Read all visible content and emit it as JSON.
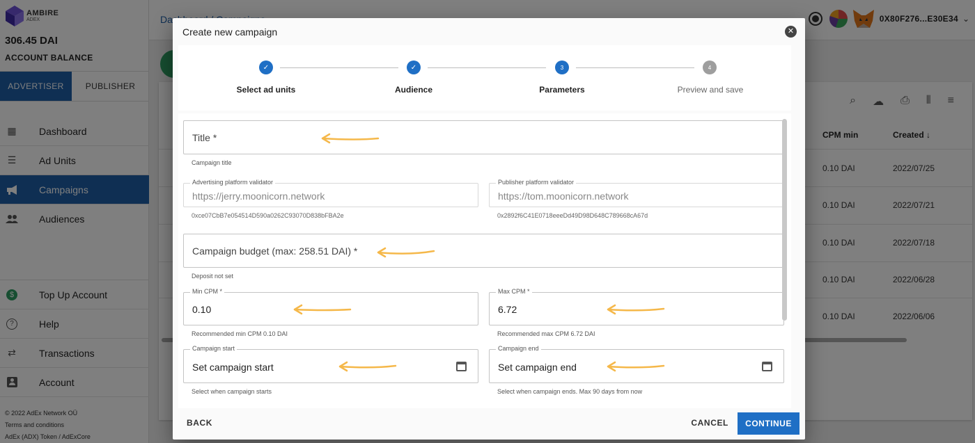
{
  "brand": {
    "name": "AMBIRE",
    "sub": "ADEX"
  },
  "sidebar": {
    "balance": "306.45 DAI",
    "balance_label": "ACCOUNT BALANCE",
    "tabs": [
      "ADVERTISER",
      "PUBLISHER"
    ],
    "items": [
      {
        "label": "Dashboard",
        "icon": "dashboard-icon"
      },
      {
        "label": "Ad Units",
        "icon": "list-icon"
      },
      {
        "label": "Campaigns",
        "icon": "megaphone-icon"
      },
      {
        "label": "Audiences",
        "icon": "people-icon"
      },
      {
        "label": "Top Up Account",
        "icon": "dollar-icon"
      },
      {
        "label": "Help",
        "icon": "help-icon"
      },
      {
        "label": "Transactions",
        "icon": "swap-icon"
      },
      {
        "label": "Account",
        "icon": "account-icon"
      }
    ],
    "footer": [
      "© 2022  AdEx Network OÜ",
      "Terms and conditions",
      "AdEx (ADX) Token / AdExCore"
    ]
  },
  "header": {
    "breadcrumb": "Dashboard / Campaigns",
    "account": "0X80F276...E30E34"
  },
  "table": {
    "columns": [
      "CPM min",
      "Created"
    ],
    "rows": [
      {
        "cpm": "0.10 DAI",
        "created": "2022/07/25"
      },
      {
        "cpm": "0.10 DAI",
        "created": "2022/07/21"
      },
      {
        "cpm": "0.10 DAI",
        "created": "2022/07/18"
      },
      {
        "cpm": "0.10 DAI",
        "created": "2022/06/28"
      },
      {
        "cpm": "0.10 DAI",
        "created": "2022/06/06"
      }
    ]
  },
  "modal": {
    "title": "Create new campaign",
    "steps": [
      {
        "label": "Select ad units",
        "state": "done"
      },
      {
        "label": "Audience",
        "state": "done"
      },
      {
        "label": "Parameters",
        "state": "current",
        "number": "3"
      },
      {
        "label": "Preview and save",
        "state": "todo",
        "number": "4"
      }
    ],
    "form": {
      "title_placeholder": "Title *",
      "title_helper": "Campaign title",
      "adv_validator_label": "Advertising platform validator",
      "adv_validator_value": "https://jerry.moonicorn.network",
      "adv_validator_address": "0xce07CbB7e054514D590a0262C93070D838bFBA2e",
      "pub_validator_label": "Publisher platform validator",
      "pub_validator_value": "https://tom.moonicorn.network",
      "pub_validator_address": "0x2892f6C41E0718eeeDd49D98D648C789668cA67d",
      "budget_placeholder": "Campaign budget (max: 258.51 DAI) *",
      "budget_helper": "Deposit not set",
      "min_cpm_label": "Min CPM *",
      "min_cpm_value": "0.10",
      "min_cpm_helper": "Recommended min CPM 0.10 DAI",
      "max_cpm_label": "Max CPM *",
      "max_cpm_value": "6.72",
      "max_cpm_helper": "Recommended max CPM 6.72 DAI",
      "start_label": "Campaign start",
      "start_value": "Set campaign start",
      "start_helper": "Select when campaign starts",
      "end_label": "Campaign end",
      "end_value": "Set campaign end",
      "end_helper": "Select when campaign ends. Max 90 days from now"
    },
    "footer": {
      "back": "BACK",
      "cancel": "CANCEL",
      "continue": "CONTINUE"
    }
  },
  "colors": {
    "primary": "#1f6fc5",
    "sidebar_active": "#1f5fa6",
    "annotation_arrow": "#f5b84a"
  }
}
